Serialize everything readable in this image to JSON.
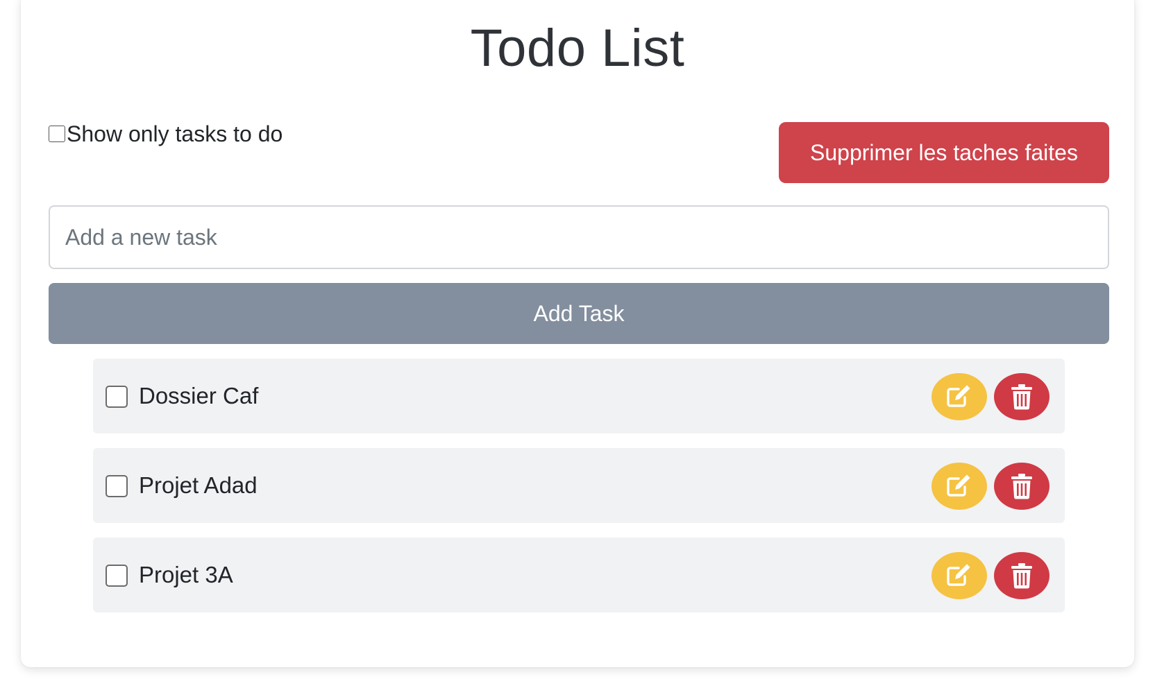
{
  "title": "Todo List",
  "filter": {
    "label": "Show only tasks to do",
    "checked": false
  },
  "delete_done_button": {
    "label": "Supprimer les taches faites"
  },
  "new_task": {
    "placeholder": "Add a new task",
    "value": ""
  },
  "add_button": {
    "label": "Add Task"
  },
  "tasks": [
    {
      "label": "Dossier Caf",
      "done": false
    },
    {
      "label": "Projet Adad",
      "done": false
    },
    {
      "label": "Projet 3A",
      "done": false
    }
  ],
  "icons": {
    "edit": "edit-icon",
    "delete": "trash-icon"
  },
  "colors": {
    "danger": "#cf434b",
    "secondary": "#838f9e",
    "warning": "#f5c242",
    "task_bg": "#f1f2f4"
  }
}
